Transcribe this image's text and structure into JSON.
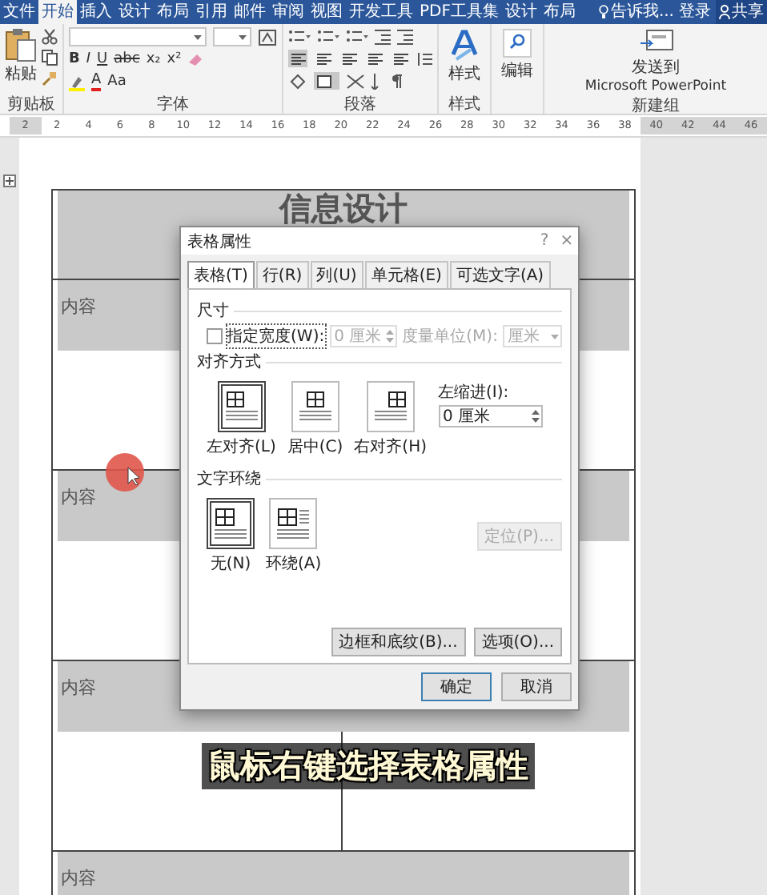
{
  "ribbon_tabs": [
    {
      "label": "文件",
      "selected": false
    },
    {
      "label": "开始",
      "selected": true
    },
    {
      "label": "插入",
      "selected": false
    },
    {
      "label": "设计",
      "selected": false
    },
    {
      "label": "布局",
      "selected": false
    },
    {
      "label": "引用",
      "selected": false
    },
    {
      "label": "邮件",
      "selected": false
    },
    {
      "label": "审阅",
      "selected": false
    },
    {
      "label": "视图",
      "selected": false
    },
    {
      "label": "开发工具",
      "selected": false
    },
    {
      "label": "PDF工具集",
      "selected": false
    },
    {
      "label": "设计",
      "selected": false
    },
    {
      "label": "布局",
      "selected": false
    }
  ],
  "tell_me": "告诉我...",
  "login": "登录",
  "share": "共享",
  "clipboard": {
    "paste": "粘贴",
    "label": "剪贴板"
  },
  "font": {
    "label": "字体",
    "format_buttons": [
      "B",
      "I",
      "U",
      "abc",
      "x₂",
      "x²"
    ],
    "color_buttons": [
      "A",
      "Aa"
    ]
  },
  "paragraph": {
    "label": "段落",
    "align_buttons": [
      {
        "selected": true
      },
      {
        "selected": false
      },
      {
        "selected": false
      },
      {
        "selected": false
      },
      {
        "selected": false
      }
    ]
  },
  "styles": {
    "button": "样式",
    "label": "样式"
  },
  "editing": {
    "button": "编辑"
  },
  "new_group": {
    "button_line1": "发送到",
    "button_line2": "Microsoft PowerPoint",
    "label": "新建组"
  },
  "ruler": [
    {
      "label": "2",
      "margin": true
    },
    {
      "label": "2",
      "margin": false
    },
    {
      "label": "4",
      "margin": false
    },
    {
      "label": "6",
      "margin": false
    },
    {
      "label": "8",
      "margin": false
    },
    {
      "label": "10",
      "margin": false
    },
    {
      "label": "12",
      "margin": false
    },
    {
      "label": "14",
      "margin": false
    },
    {
      "label": "16",
      "margin": false
    },
    {
      "label": "18",
      "margin": false
    },
    {
      "label": "20",
      "margin": false
    },
    {
      "label": "22",
      "margin": false
    },
    {
      "label": "24",
      "margin": false
    },
    {
      "label": "26",
      "margin": false
    },
    {
      "label": "28",
      "margin": false
    },
    {
      "label": "30",
      "margin": false
    },
    {
      "label": "32",
      "margin": false
    },
    {
      "label": "34",
      "margin": false
    },
    {
      "label": "36",
      "margin": false
    },
    {
      "label": "38",
      "margin": false
    },
    {
      "label": "40",
      "margin": true
    },
    {
      "label": "42",
      "margin": true
    },
    {
      "label": "44",
      "margin": true
    },
    {
      "label": "46",
      "margin": true
    }
  ],
  "document": {
    "title": "信息设计",
    "rows": [
      "内容",
      "内容",
      "内容",
      "内容"
    ]
  },
  "dialog": {
    "title": "表格属性",
    "help": "?",
    "close": "×",
    "tabs": [
      {
        "label": "表格(T)",
        "selected": true
      },
      {
        "label": "行(R)",
        "selected": false
      },
      {
        "label": "列(U)",
        "selected": false
      },
      {
        "label": "单元格(E)",
        "selected": false
      },
      {
        "label": "可选文字(A)",
        "selected": false
      }
    ],
    "size": {
      "heading": "尺寸",
      "width_checkbox": {
        "label": "指定宽度(W):",
        "checked": false
      },
      "width_field": {
        "value": "0 厘米",
        "disabled": true
      },
      "unit_label": "度量单位(M):",
      "unit_select": {
        "value": "厘米",
        "disabled": true
      }
    },
    "alignment": {
      "heading": "对齐方式",
      "options": [
        {
          "label": "左对齐(L)",
          "selected": true
        },
        {
          "label": "居中(C)",
          "selected": false
        },
        {
          "label": "右对齐(H)",
          "selected": false
        }
      ],
      "indent_label": "左缩进(I):",
      "indent_value": "0 厘米"
    },
    "wrapping": {
      "heading": "文字环绕",
      "options": [
        {
          "label": "无(N)",
          "selected": true
        },
        {
          "label": "环绕(A)",
          "selected": false
        }
      ],
      "position_button": {
        "label": "定位(P)...",
        "disabled": true
      }
    },
    "panel_buttons": [
      "边框和底纹(B)...",
      "选项(O)..."
    ],
    "footer_buttons": [
      "确定",
      "取消"
    ]
  },
  "subtitle": "鼠标右键选择表格属性"
}
